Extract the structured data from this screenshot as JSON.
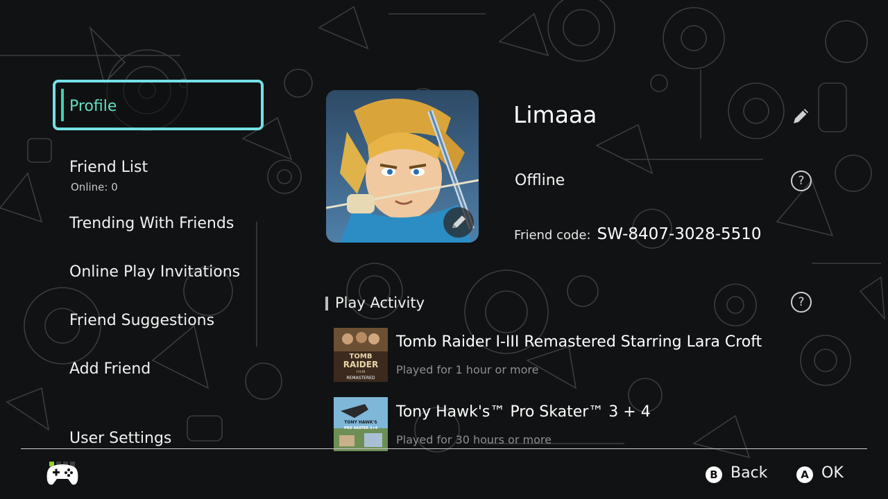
{
  "sidebar": {
    "profile_label": "Profile",
    "friend_list_label": "Friend List",
    "friend_list_sub": "Online: 0",
    "trending_label": "Trending With Friends",
    "invitations_label": "Online Play Invitations",
    "suggestions_label": "Friend Suggestions",
    "add_friend_label": "Add Friend",
    "user_settings_label": "User Settings"
  },
  "profile": {
    "username": "Limaaa",
    "status": "Offline",
    "friend_code_label": "Friend code:",
    "friend_code_value": "SW-8407-3028-5510"
  },
  "play_activity": {
    "title": "Play Activity",
    "games": [
      {
        "title": "Tomb Raider I-III Remastered Starring Lara Croft",
        "playtime": "Played for 1 hour or more"
      },
      {
        "title": "Tony Hawk's™ Pro Skater™ 3 + 4",
        "playtime": "Played for 30 hours or more"
      }
    ]
  },
  "thumb_text": {
    "tomb_line1": "TOMB",
    "tomb_line2": "RAIDER",
    "tomb_line3": "I-II-III",
    "tomb_line4": "REMASTERED",
    "tony_line1": "TONY HAWK'S",
    "tony_line2": "PRO SKATER 3+4"
  },
  "footer": {
    "back_key": "B",
    "back_label": "Back",
    "ok_key": "A",
    "ok_label": "OK"
  },
  "colors": {
    "selection_border": "#74e1e6",
    "selection_text": "#5ee0c2",
    "background": "#111213",
    "indicator_green": "#8ed22a"
  },
  "icons": {
    "edit": "pencil-icon",
    "help": "question-circle-icon",
    "controller": "gamepad-icon"
  }
}
